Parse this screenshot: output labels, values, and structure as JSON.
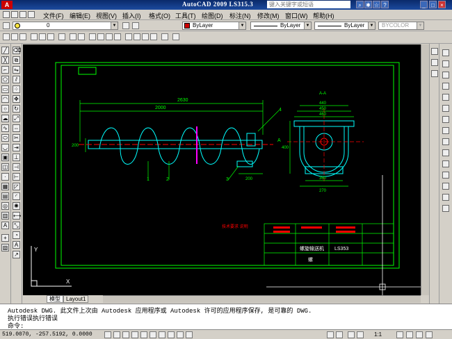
{
  "title_bar": {
    "app_title": "AutoCAD 2009  LS315.3",
    "search_placeholder": "键入关键字或短语",
    "window_controls": [
      "minimize",
      "restore",
      "close"
    ]
  },
  "menu": {
    "items": [
      "文件(F)",
      "编辑(E)",
      "视图(V)",
      "插入(I)",
      "格式(O)",
      "工具(T)",
      "绘图(D)",
      "标注(N)",
      "修改(M)",
      "窗口(W)",
      "帮助(H)"
    ]
  },
  "toolbar": {
    "layer_value": "0",
    "color_value": "ByLayer",
    "linetype_value": "ByLayer",
    "lineweight_value": "ByLayer",
    "plotstyle_value": "BYCOLOR"
  },
  "drawing": {
    "dims": {
      "overall": "2630",
      "top_span": "2000",
      "height_left": "200",
      "bottom_right": "200",
      "side_top1": "440",
      "side_top2": "450",
      "side_top3": "460",
      "side_height": "400",
      "side_bottom1": "360",
      "side_bottom2": "270",
      "section_label": "A-A",
      "section_mark": "A"
    },
    "balloons": [
      "1",
      "2",
      "3",
      "4"
    ],
    "tech_note": "技术要求 说明",
    "title_block": {
      "drawing_no": "LS353",
      "name": "螺旋输送机",
      "part": "螺"
    },
    "ucs": {
      "x": "X",
      "y": "Y"
    }
  },
  "tabs": {
    "model": "模型",
    "layout1": "Layout1"
  },
  "command": {
    "line1": "Autodesk DWG.  此文件上次由 Autodesk 应用程序或 Autodesk 许可的应用程序保存, 是可靠的 DWG.",
    "line2": "执行错误执行错误",
    "prompt": "命令:"
  },
  "status": {
    "coords": "519.0070, -257.5192, 0.0000",
    "scale": "1:1"
  },
  "colors": {
    "canvas_bg": "#000000",
    "titlebar": "#1c4a9e",
    "border_line": "#00ff00",
    "geometry": "#00ffff",
    "dim_line": "#00ff00",
    "center_line": "#ff0000",
    "highlight": "#ff00ff"
  }
}
